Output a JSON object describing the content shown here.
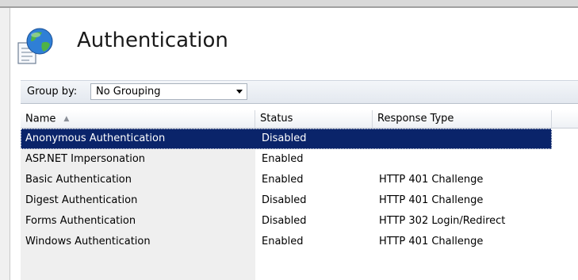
{
  "page": {
    "title": "Authentication",
    "icon": "authentication-globe-icon"
  },
  "toolbar": {
    "group_by_label": "Group by:",
    "group_by_value": "No Grouping",
    "dropdown_icon": "dropdown-arrow-icon"
  },
  "grid": {
    "columns": [
      {
        "label": "Name",
        "sort": "ascending"
      },
      {
        "label": "Status"
      },
      {
        "label": "Response Type"
      },
      {
        "label": ""
      }
    ],
    "rows": [
      {
        "name": "Anonymous Authentication",
        "status": "Disabled",
        "response_type": "",
        "selected": true
      },
      {
        "name": "ASP.NET Impersonation",
        "status": "Enabled",
        "response_type": ""
      },
      {
        "name": "Basic Authentication",
        "status": "Enabled",
        "response_type": "HTTP 401 Challenge"
      },
      {
        "name": "Digest Authentication",
        "status": "Disabled",
        "response_type": "HTTP 401 Challenge"
      },
      {
        "name": "Forms Authentication",
        "status": "Disabled",
        "response_type": "HTTP 302 Login/Redirect"
      },
      {
        "name": "Windows Authentication",
        "status": "Enabled",
        "response_type": "HTTP 401 Challenge"
      }
    ]
  },
  "colors": {
    "selection": "#0a246a",
    "name_column_bg": "#efefef"
  }
}
